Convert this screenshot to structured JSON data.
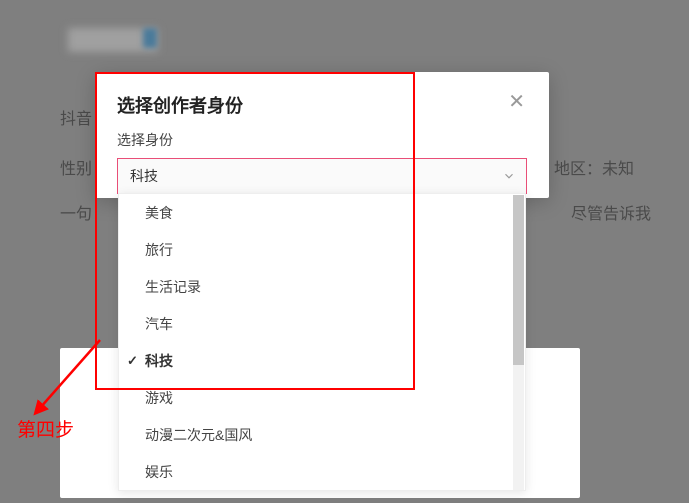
{
  "background": {
    "line1_left": "抖音",
    "line2_left": "性别",
    "line2_right": "地区：未知",
    "line3_left": "一句",
    "line3_right": "尽管告诉我"
  },
  "annotation": {
    "step_label": "第四步"
  },
  "modal": {
    "title": "选择创作者身份",
    "field_label": "选择身份",
    "selected_value": "科技",
    "options": [
      {
        "label": "美食",
        "selected": false
      },
      {
        "label": "旅行",
        "selected": false
      },
      {
        "label": "生活记录",
        "selected": false
      },
      {
        "label": "汽车",
        "selected": false
      },
      {
        "label": "科技",
        "selected": true
      },
      {
        "label": "游戏",
        "selected": false
      },
      {
        "label": "动漫二次元&国风",
        "selected": false
      },
      {
        "label": "娱乐",
        "selected": false
      }
    ]
  }
}
